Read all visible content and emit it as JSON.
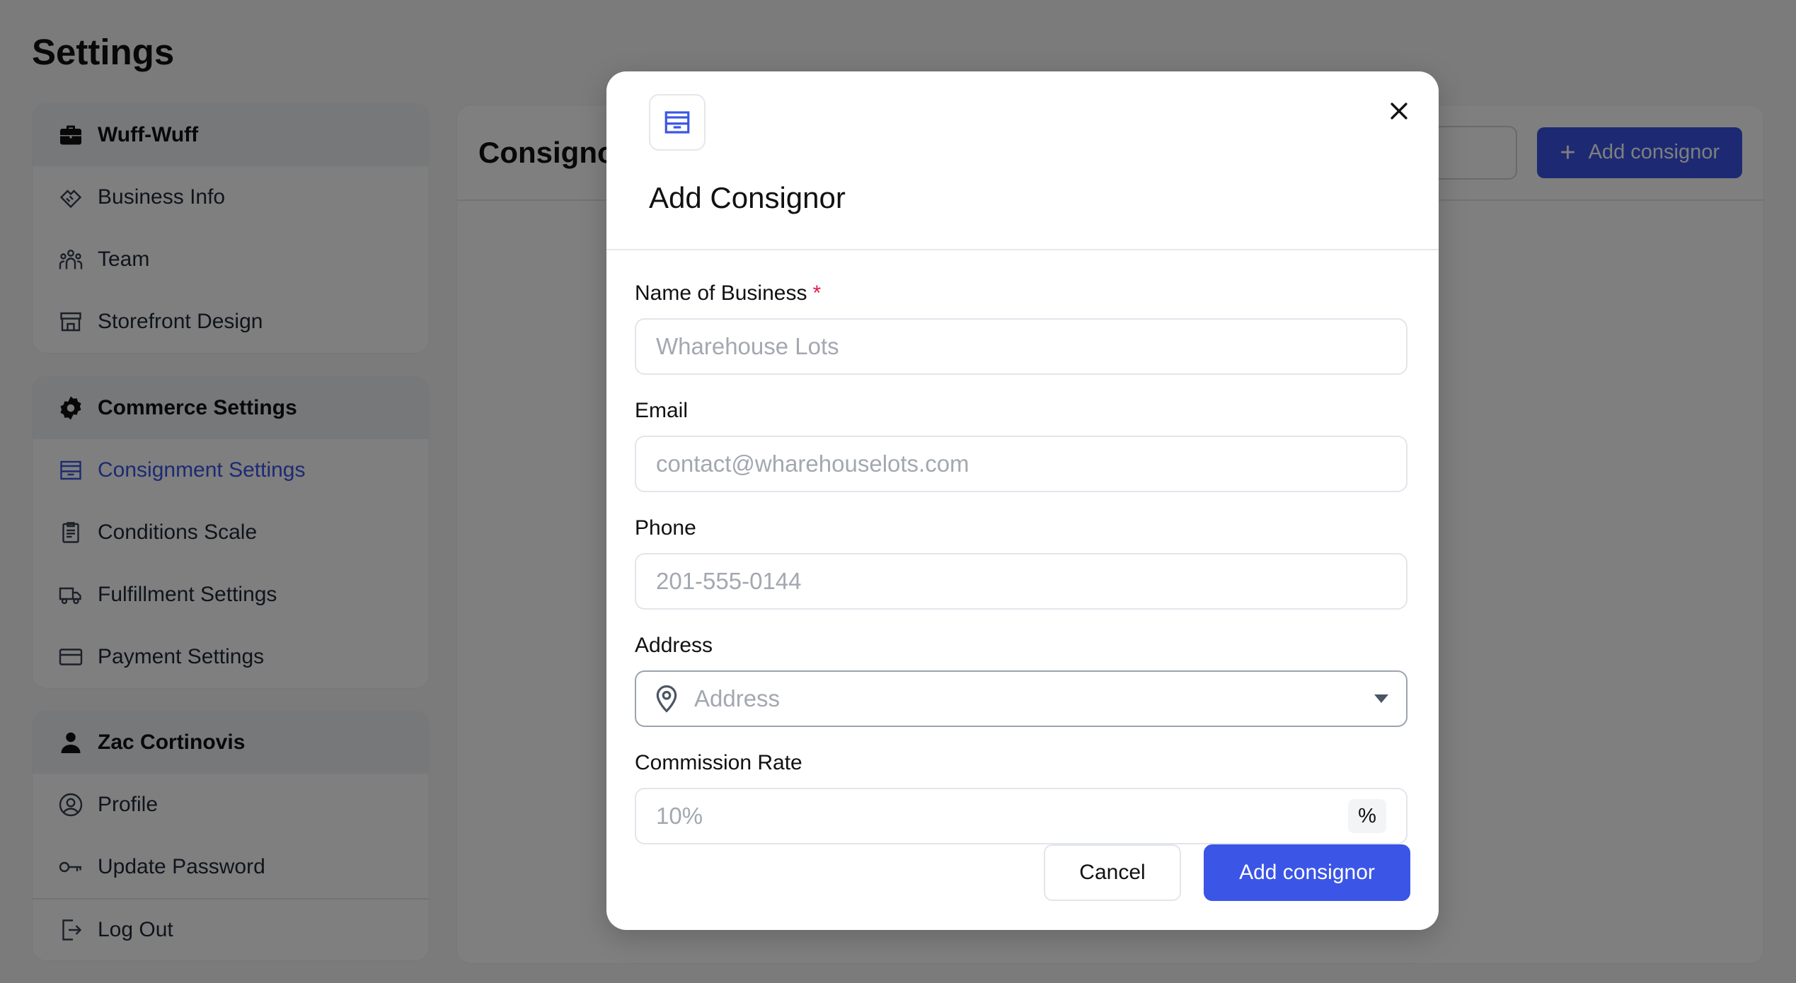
{
  "page": {
    "title": "Settings"
  },
  "sidebar": {
    "business": {
      "heading": "Wuff-Wuff",
      "heading_icon": "briefcase-icon",
      "items": [
        {
          "label": "Business Info",
          "icon": "handshake-icon"
        },
        {
          "label": "Team",
          "icon": "team-icon"
        },
        {
          "label": "Storefront Design",
          "icon": "storefront-icon"
        }
      ]
    },
    "commerce": {
      "heading": "Commerce Settings",
      "heading_icon": "gear-icon",
      "items": [
        {
          "label": "Consignment Settings",
          "icon": "archive-box-icon",
          "active": true
        },
        {
          "label": "Conditions Scale",
          "icon": "clipboard-icon"
        },
        {
          "label": "Fulfillment Settings",
          "icon": "truck-icon"
        },
        {
          "label": "Payment Settings",
          "icon": "credit-card-icon"
        }
      ]
    },
    "user": {
      "heading": "Zac Cortinovis",
      "heading_icon": "person-icon",
      "items": [
        {
          "label": "Profile",
          "icon": "user-circle-icon"
        },
        {
          "label": "Update Password",
          "icon": "key-icon"
        }
      ],
      "logout": {
        "label": "Log Out",
        "icon": "logout-icon"
      }
    }
  },
  "main": {
    "title": "Consignors",
    "add_button": "Add consignor"
  },
  "modal": {
    "title": "Add Consignor",
    "fields": {
      "business_name": {
        "label": "Name of Business",
        "required_mark": "*",
        "placeholder": "Wharehouse Lots",
        "value": ""
      },
      "email": {
        "label": "Email",
        "placeholder": "contact@wharehouselots.com",
        "value": ""
      },
      "phone": {
        "label": "Phone",
        "placeholder": "201-555-0144",
        "value": ""
      },
      "address": {
        "label": "Address",
        "placeholder": "Address",
        "value": ""
      },
      "commission": {
        "label": "Commission Rate",
        "placeholder": "10%",
        "value": "",
        "suffix": "%"
      }
    },
    "cancel_label": "Cancel",
    "submit_label": "Add consignor"
  },
  "colors": {
    "accent": "#3b55e6",
    "required": "#e11d48",
    "overlay": "rgba(0,0,0,0.5)"
  }
}
